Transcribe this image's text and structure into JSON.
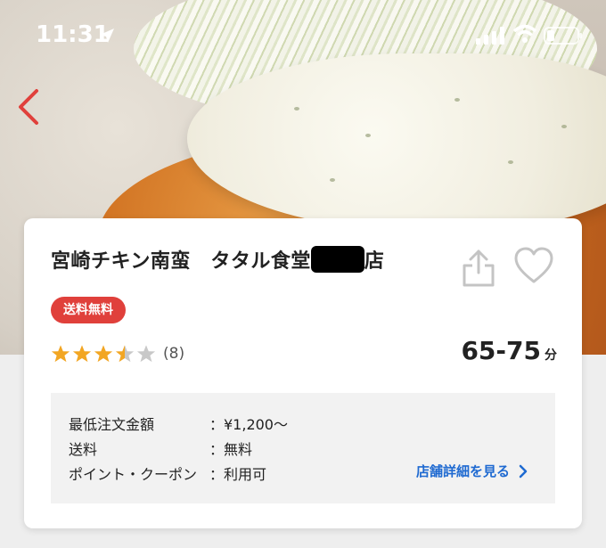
{
  "status_bar": {
    "time": "11:31"
  },
  "store": {
    "name_part1": "宮崎チキン南蛮　タタル食堂",
    "name_part2": "店",
    "badge": "送料無料",
    "rating_value": 3.5,
    "review_count": "(8)",
    "delivery_time": "65-75",
    "delivery_unit": "分"
  },
  "info": {
    "rows": [
      {
        "label": "最低注文金額",
        "value": "：¥1,200～"
      },
      {
        "label": "送料",
        "value": "：無料"
      },
      {
        "label": "ポイント・クーポン",
        "value": "：利用可"
      }
    ],
    "detail_link": "店舗詳細を見る"
  },
  "colors": {
    "badge": "#e0403b",
    "link": "#1f6ad1",
    "star": "#f2a623",
    "star_empty": "#c8c8c8"
  }
}
